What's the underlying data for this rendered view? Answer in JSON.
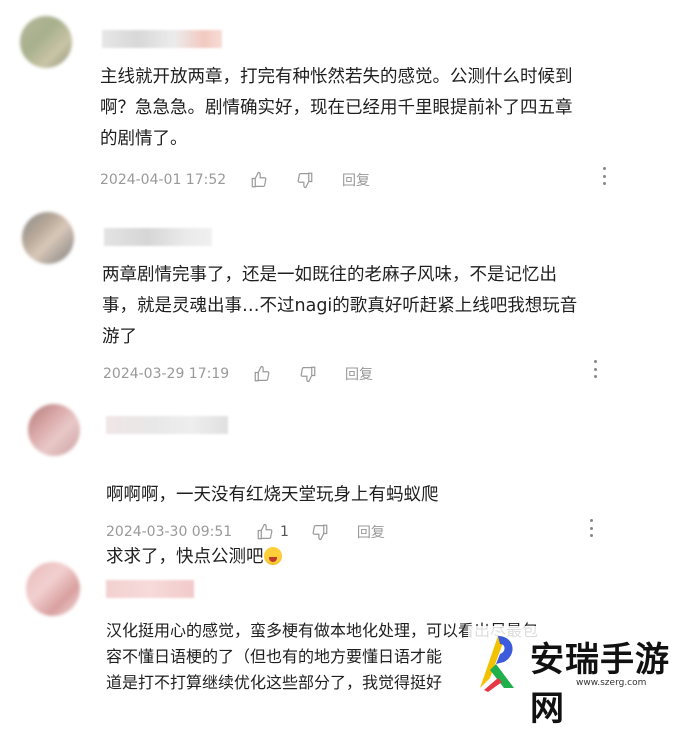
{
  "comments": [
    {
      "lines": "主线就开放两章，打完有种怅然若失的感觉。公测什么时候到\n啊？急急急。剧情确实好，现在已经用千里眼提前补了四五章\n的剧情了。",
      "date": "2024-04-01 17:52",
      "like_count": "",
      "reply_label": "回复"
    },
    {
      "lines": "两章剧情完事了，还是一如既往的老麻子风味，不是记忆出\n事，就是灵魂出事…不过nagi的歌真好听赶紧上线吧我想玩音\n游了",
      "date": "2024-03-29 17:19",
      "like_count": "",
      "reply_label": "回复"
    },
    {
      "line1": "啊啊啊，一天没有红烧天堂玩身上有蚂蚁爬",
      "line2": "求求了，快点公测吧",
      "date": "2024-03-30 09:51",
      "like_count": "1",
      "reply_label": "回复"
    },
    {
      "lines": "汉化挺用心的感觉，蛮多梗有做本地化处理，可以看出尽最包\n容不懂日语梗的了（但也有的地方要懂日语才能\n道是打不打算继续优化这些部分了，我觉得挺好"
    }
  ],
  "icons": {
    "like": "thumbs-up-icon",
    "dislike": "thumbs-down-icon",
    "more": "more-vertical-icon",
    "emoji": "crying-face-emoji"
  },
  "watermark": {
    "title": "安瑞手游网",
    "url": "www.szerg.com"
  },
  "colors": {
    "meta_text": "#999999",
    "content_text": "#1f1f1f"
  }
}
